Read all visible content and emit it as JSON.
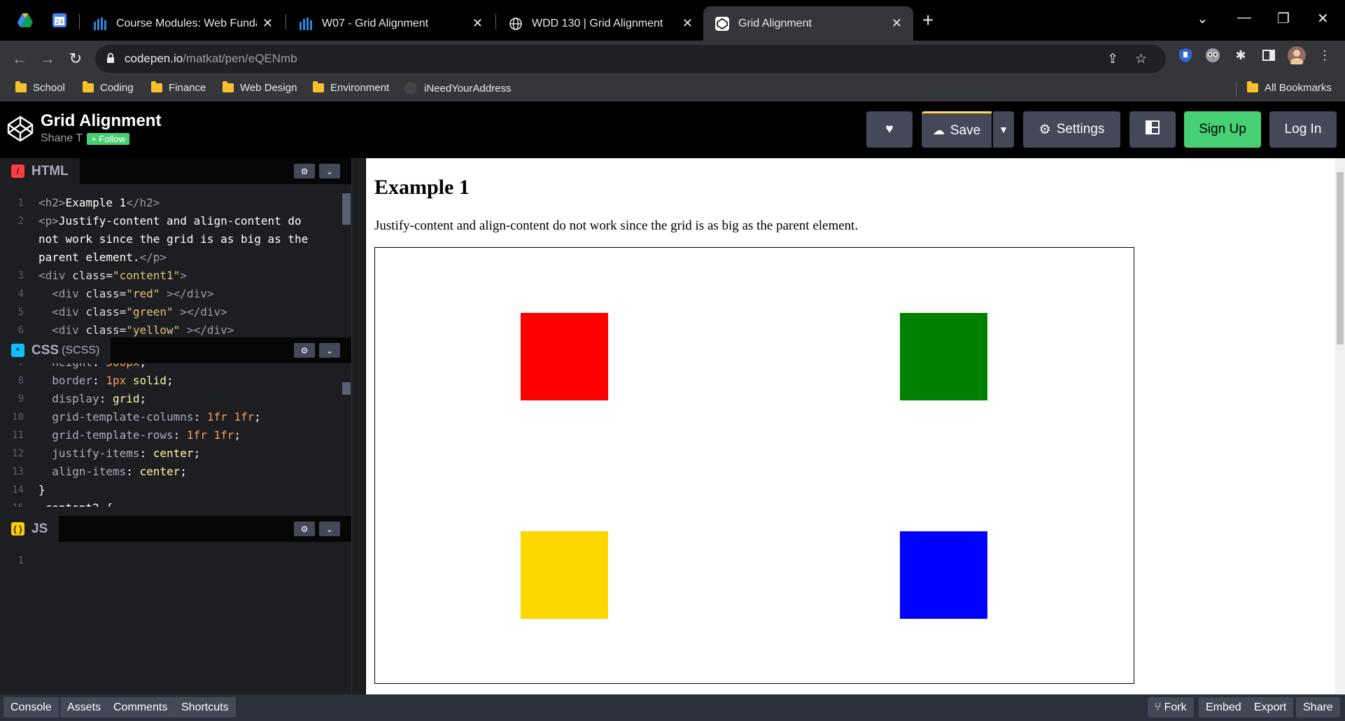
{
  "browser": {
    "tabs": [
      {
        "title": "Course Modules: Web Fundamer",
        "close": "✕"
      },
      {
        "title": "W07 - Grid Alignment",
        "close": "✕"
      },
      {
        "title": "WDD 130 | Grid Alignment",
        "close": "✕"
      },
      {
        "title": "Grid Alignment",
        "close": "✕"
      }
    ],
    "url_host": "codepen.io",
    "url_path": "/matkat/pen/eQENmb",
    "bookmarks": [
      "School",
      "Coding",
      "Finance",
      "Web Design",
      "Environment",
      "iNeedYourAddress"
    ],
    "all_bookmarks": "All Bookmarks"
  },
  "codepen": {
    "title": "Grid Alignment",
    "author": "Shane T",
    "follow": "+ Follow",
    "buttons": {
      "save": "Save",
      "settings": "Settings",
      "signup": "Sign Up",
      "login": "Log In"
    }
  },
  "editors": {
    "html_label": "HTML",
    "css_label": "CSS",
    "css_sub": "(SCSS)",
    "js_label": "JS"
  },
  "preview": {
    "heading": "Example 1",
    "paragraph": "Justify-content and align-content do not work since the grid is as big as the parent element.",
    "colors": {
      "red": "#ff0000",
      "green": "#008000",
      "yellow": "#ffd700",
      "blue": "#0000ff"
    }
  },
  "footer": {
    "left": [
      "Console",
      "Assets",
      "Comments",
      "Shortcuts"
    ],
    "right": [
      "Fork",
      "Embed",
      "Export",
      "Share"
    ]
  }
}
